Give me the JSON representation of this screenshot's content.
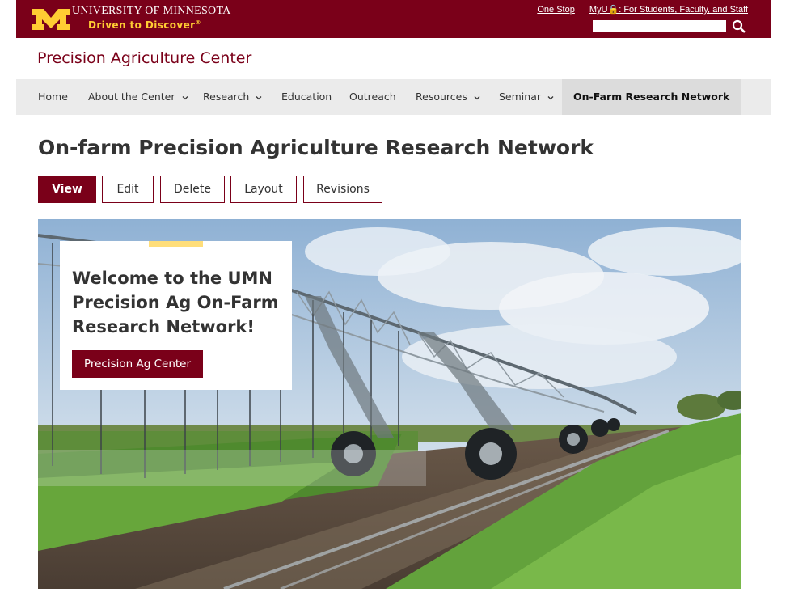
{
  "header": {
    "university_name": "University of Minnesota",
    "tagline": "Driven to Discover",
    "links": [
      "One Stop",
      "MyU🔒: For Students, Faculty, and Staff"
    ],
    "search_value": ""
  },
  "site": {
    "title": "Precision Agriculture Center"
  },
  "nav": {
    "items": [
      {
        "label": "Home"
      },
      {
        "label": "About the Center"
      },
      {
        "label": "Research"
      },
      {
        "label": "Education"
      },
      {
        "label": "Outreach"
      },
      {
        "label": "Resources"
      },
      {
        "label": "Seminar"
      },
      {
        "label": "On-Farm Research Network"
      }
    ],
    "active": "On-Farm Research Network"
  },
  "page": {
    "title": "On-farm Precision Agriculture Research Network"
  },
  "tabs": [
    "View",
    "Edit",
    "Delete",
    "Layout",
    "Revisions"
  ],
  "hero": {
    "heading": "Welcome to the UMN Precision Ag On-Farm Research Network!",
    "button_label": "Precision Ag Center"
  },
  "colors": {
    "maroon": "#7a0019",
    "gold": "#ffcc33",
    "accent": "#ffde7a"
  }
}
